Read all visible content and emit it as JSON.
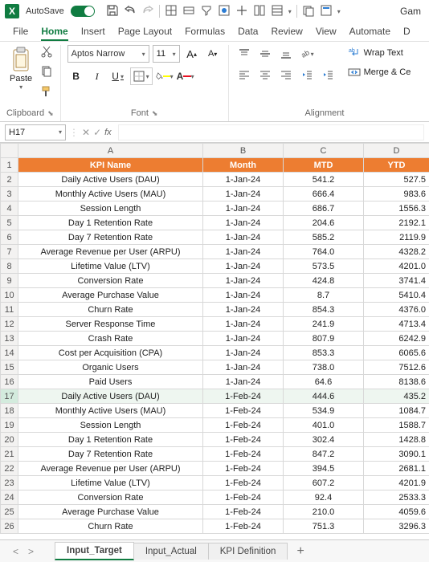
{
  "titlebar": {
    "autosave_label": "AutoSave",
    "autosave_state": "On",
    "doc_title": "Gam"
  },
  "tabs": {
    "file": "File",
    "home": "Home",
    "insert": "Insert",
    "page_layout": "Page Layout",
    "formulas": "Formulas",
    "data": "Data",
    "review": "Review",
    "view": "View",
    "automate": "Automate",
    "more": "D"
  },
  "ribbon": {
    "clipboard": {
      "label": "Clipboard",
      "paste": "Paste"
    },
    "font": {
      "label": "Font",
      "font_name": "Aptos Narrow",
      "font_size": "11",
      "grow": "A",
      "shrink": "A",
      "bold": "B",
      "italic": "I",
      "underline": "U"
    },
    "alignment": {
      "label": "Alignment",
      "wrap": "Wrap Text",
      "merge": "Merge & Ce"
    }
  },
  "formula_bar": {
    "cell_ref": "H17",
    "fx": "fx",
    "value": ""
  },
  "columns": [
    "A",
    "B",
    "C",
    "D"
  ],
  "header_row": {
    "a": "KPI Name",
    "b": "Month",
    "c": "MTD",
    "d": "YTD"
  },
  "rows": [
    {
      "n": "1"
    },
    {
      "n": "2",
      "a": "Daily Active Users (DAU)",
      "b": "1-Jan-24",
      "c": "541.2",
      "d": "527.5"
    },
    {
      "n": "3",
      "a": "Monthly Active Users (MAU)",
      "b": "1-Jan-24",
      "c": "666.4",
      "d": "983.6"
    },
    {
      "n": "4",
      "a": "Session Length",
      "b": "1-Jan-24",
      "c": "686.7",
      "d": "1556.3"
    },
    {
      "n": "5",
      "a": "Day 1 Retention Rate",
      "b": "1-Jan-24",
      "c": "204.6",
      "d": "2192.1"
    },
    {
      "n": "6",
      "a": "Day 7 Retention Rate",
      "b": "1-Jan-24",
      "c": "585.2",
      "d": "2119.9"
    },
    {
      "n": "7",
      "a": "Average Revenue per User (ARPU)",
      "b": "1-Jan-24",
      "c": "764.0",
      "d": "4328.2"
    },
    {
      "n": "8",
      "a": "Lifetime Value (LTV)",
      "b": "1-Jan-24",
      "c": "573.5",
      "d": "4201.0"
    },
    {
      "n": "9",
      "a": "Conversion Rate",
      "b": "1-Jan-24",
      "c": "424.8",
      "d": "3741.4"
    },
    {
      "n": "10",
      "a": "Average Purchase Value",
      "b": "1-Jan-24",
      "c": "8.7",
      "d": "5410.4"
    },
    {
      "n": "11",
      "a": "Churn Rate",
      "b": "1-Jan-24",
      "c": "854.3",
      "d": "4376.0"
    },
    {
      "n": "12",
      "a": "Server Response Time",
      "b": "1-Jan-24",
      "c": "241.9",
      "d": "4713.4"
    },
    {
      "n": "13",
      "a": "Crash Rate",
      "b": "1-Jan-24",
      "c": "807.9",
      "d": "6242.9"
    },
    {
      "n": "14",
      "a": "Cost per Acquisition (CPA)",
      "b": "1-Jan-24",
      "c": "853.3",
      "d": "6065.6"
    },
    {
      "n": "15",
      "a": "Organic Users",
      "b": "1-Jan-24",
      "c": "738.0",
      "d": "7512.6"
    },
    {
      "n": "16",
      "a": "Paid Users",
      "b": "1-Jan-24",
      "c": "64.6",
      "d": "8138.6"
    },
    {
      "n": "17",
      "a": "Daily Active Users (DAU)",
      "b": "1-Feb-24",
      "c": "444.6",
      "d": "435.2"
    },
    {
      "n": "18",
      "a": "Monthly Active Users (MAU)",
      "b": "1-Feb-24",
      "c": "534.9",
      "d": "1084.7"
    },
    {
      "n": "19",
      "a": "Session Length",
      "b": "1-Feb-24",
      "c": "401.0",
      "d": "1588.7"
    },
    {
      "n": "20",
      "a": "Day 1 Retention Rate",
      "b": "1-Feb-24",
      "c": "302.4",
      "d": "1428.8"
    },
    {
      "n": "21",
      "a": "Day 7 Retention Rate",
      "b": "1-Feb-24",
      "c": "847.2",
      "d": "3090.1"
    },
    {
      "n": "22",
      "a": "Average Revenue per User (ARPU)",
      "b": "1-Feb-24",
      "c": "394.5",
      "d": "2681.1"
    },
    {
      "n": "23",
      "a": "Lifetime Value (LTV)",
      "b": "1-Feb-24",
      "c": "607.2",
      "d": "4201.9"
    },
    {
      "n": "24",
      "a": "Conversion Rate",
      "b": "1-Feb-24",
      "c": "92.4",
      "d": "2533.3"
    },
    {
      "n": "25",
      "a": "Average Purchase Value",
      "b": "1-Feb-24",
      "c": "210.0",
      "d": "4059.6"
    },
    {
      "n": "26",
      "a": "Churn Rate",
      "b": "1-Feb-24",
      "c": "751.3",
      "d": "3296.3"
    }
  ],
  "sheet_tabs": {
    "t1": "Input_Target",
    "t2": "Input_Actual",
    "t3": "KPI Definition",
    "add": "+"
  }
}
